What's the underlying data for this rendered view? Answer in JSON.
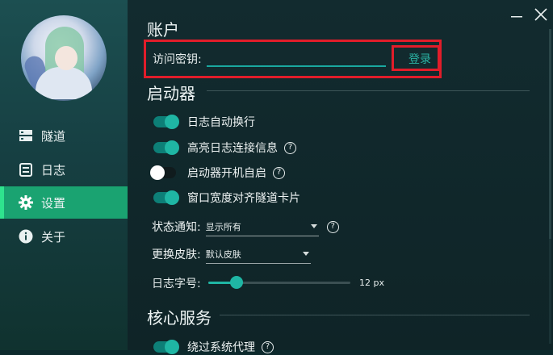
{
  "sidebar": {
    "items": [
      {
        "label": "隧道",
        "icon": "server-icon"
      },
      {
        "label": "日志",
        "icon": "log-icon"
      },
      {
        "label": "设置",
        "icon": "gear-icon",
        "active": true
      },
      {
        "label": "关于",
        "icon": "info-icon"
      }
    ]
  },
  "account": {
    "title": "账户",
    "access_key_label": "访问密钥:",
    "access_key_value": "",
    "login_label": "登录"
  },
  "launcher": {
    "title": "启动器",
    "toggles": [
      {
        "label": "日志自动换行",
        "on": true,
        "help": false
      },
      {
        "label": "高亮日志连接信息",
        "on": true,
        "help": true
      },
      {
        "label": "启动器开机自启",
        "on": false,
        "help": true
      },
      {
        "label": "窗口宽度对齐隧道卡片",
        "on": true,
        "help": false
      }
    ],
    "status_notify": {
      "label": "状态通知:",
      "value": "显示所有"
    },
    "skin": {
      "label": "更换皮肤:",
      "value": "默认皮肤"
    },
    "font_size": {
      "label": "日志字号:",
      "value_text": "12 px",
      "fraction": 0.2
    }
  },
  "core": {
    "title": "核心服务",
    "toggles": [
      {
        "label": "绕过系统代理",
        "on": true,
        "help": true
      }
    ]
  },
  "colors": {
    "accent": "#1fb6a4",
    "active_nav": "#1aa371",
    "highlight_box": "#e11d2a"
  }
}
